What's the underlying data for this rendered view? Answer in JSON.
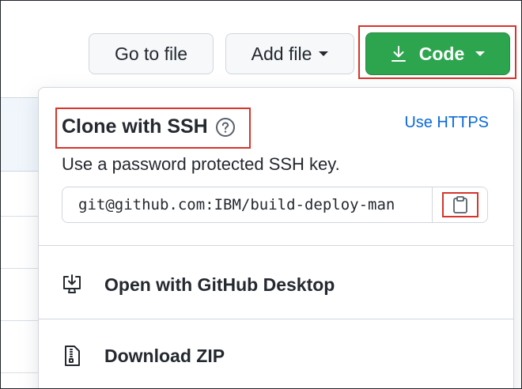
{
  "toolbar": {
    "goto_label": "Go to file",
    "add_label": "Add file",
    "code_label": "Code"
  },
  "clone": {
    "title": "Clone with SSH",
    "switch_link": "Use HTTPS",
    "description": "Use a password protected SSH key.",
    "url": "git@github.com:IBM/build-deploy-man"
  },
  "menu": [
    {
      "label": "Open with GitHub Desktop",
      "icon": "desktop-download-icon"
    },
    {
      "label": "Download ZIP",
      "icon": "file-zip-icon"
    }
  ],
  "colors": {
    "code_button": "#2da44e",
    "link": "#0969da",
    "highlight_outline": "#d8342a"
  }
}
